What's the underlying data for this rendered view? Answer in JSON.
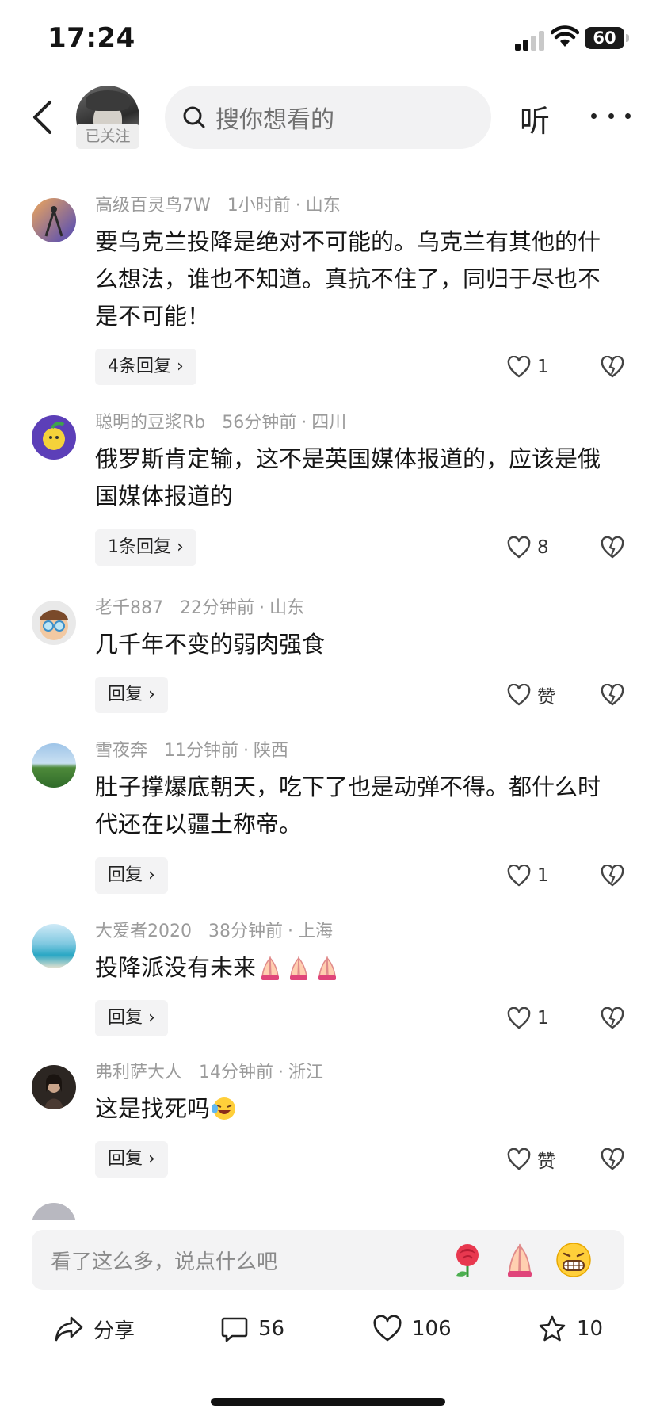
{
  "status_bar": {
    "time": "17:24",
    "battery": "60"
  },
  "header": {
    "follow_label": "已关注",
    "search_placeholder": "搜你想看的",
    "listen_label": "听"
  },
  "comments": [
    {
      "user": "高级百灵鸟7W",
      "time": "1小时前",
      "location": "山东",
      "text": "要乌克兰投降是绝对不可能的。乌克兰有其他的什么想法，谁也不知道。真抗不住了，同归于尽也不是不可能！",
      "reply_label": "4条回复",
      "likes": "1"
    },
    {
      "user": "聪明的豆浆Rb",
      "time": "56分钟前",
      "location": "四川",
      "text": "俄罗斯肯定输，这不是英国媒体报道的，应该是俄国媒体报道的",
      "reply_label": "1条回复",
      "likes": "8"
    },
    {
      "user": "老千887",
      "time": "22分钟前",
      "location": "山东",
      "text": "几千年不变的弱肉强食",
      "reply_label": "回复",
      "likes": "赞"
    },
    {
      "user": "雪夜奔",
      "time": "11分钟前",
      "location": "陕西",
      "text": "肚子撑爆底朝天，吃下了也是动弹不得。都什么时代还在以疆土称帝。",
      "reply_label": "回复",
      "likes": "1"
    },
    {
      "user": "大爱者2020",
      "time": "38分钟前",
      "location": "上海",
      "text": "投降派没有未来",
      "reply_label": "回复",
      "likes": "1"
    },
    {
      "user": "弗利萨大人",
      "time": "14分钟前",
      "location": "浙江",
      "text": "这是找死吗",
      "reply_label": "回复",
      "likes": "赞"
    }
  ],
  "input": {
    "placeholder": "看了这么多，说点什么吧"
  },
  "actions": {
    "share": "分享",
    "comments": "56",
    "likes": "106",
    "favorites": "10"
  },
  "colors": {
    "text": "#141414",
    "meta": "#9b9b9b",
    "bubble": "#f3f3f4"
  }
}
